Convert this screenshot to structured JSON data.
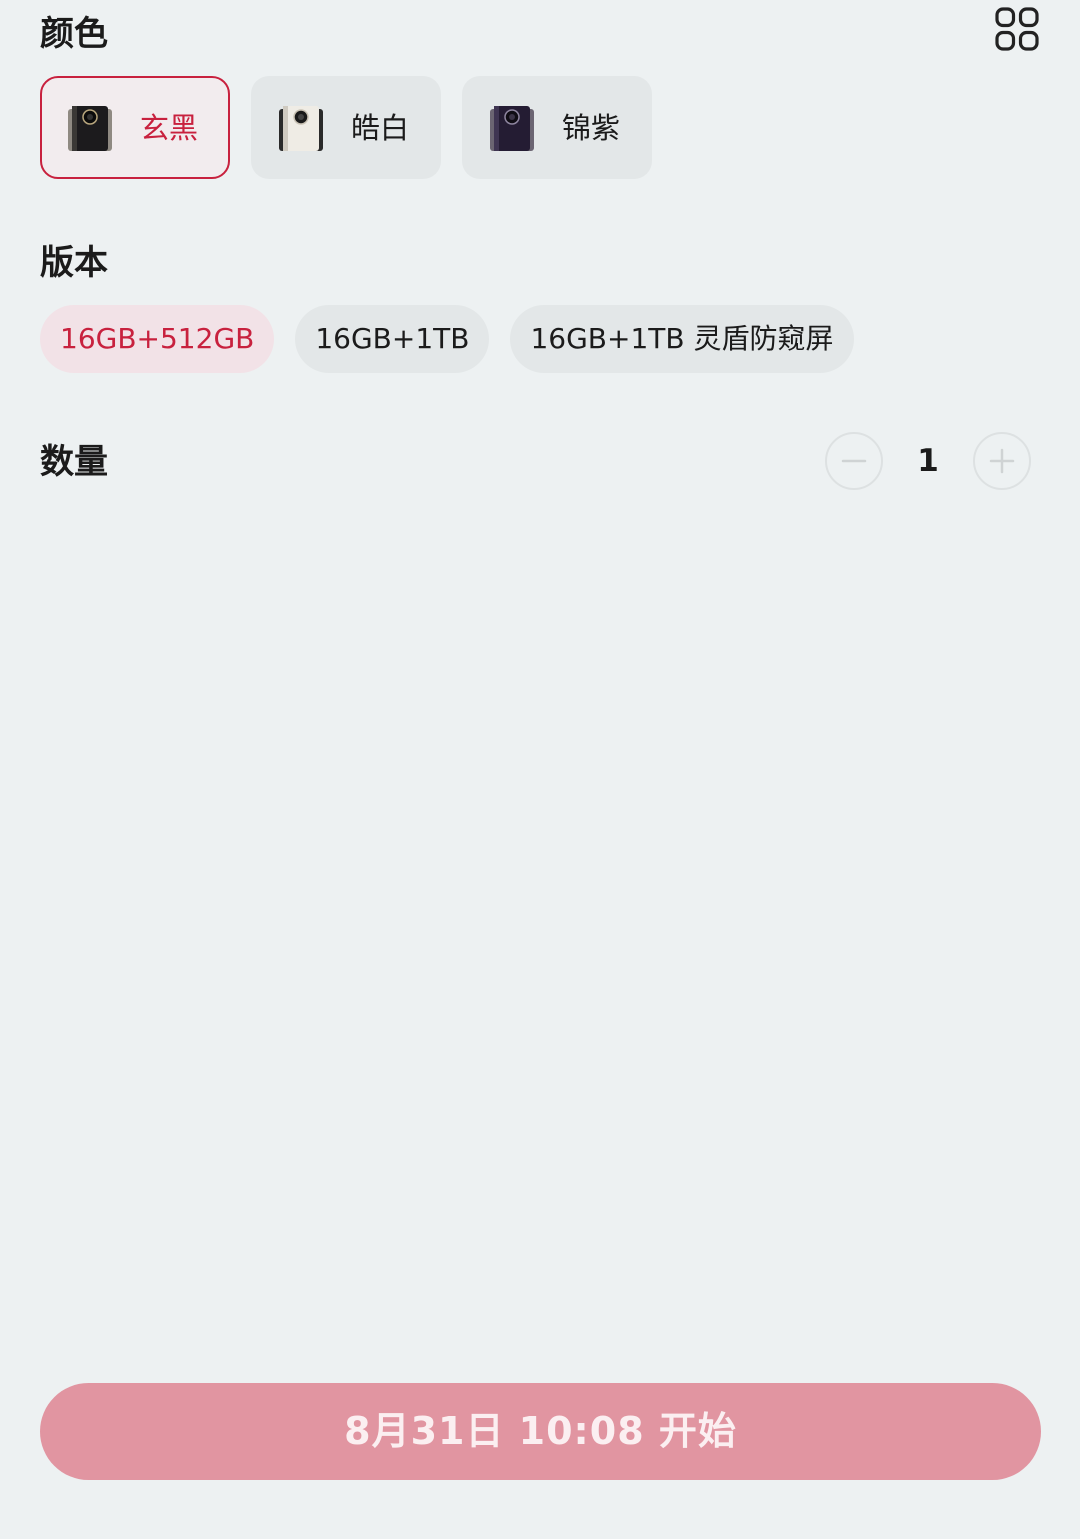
{
  "sections": {
    "color_title": "颜色",
    "version_title": "版本",
    "quantity_title": "数量"
  },
  "colors": [
    {
      "label": "玄黑",
      "selected": true,
      "swatch": "#1c1b1d"
    },
    {
      "label": "皓白",
      "selected": false,
      "swatch": "#efece5"
    },
    {
      "label": "锦紫",
      "selected": false,
      "swatch": "#241c33"
    }
  ],
  "versions": [
    {
      "label": "16GB+512GB",
      "selected": true
    },
    {
      "label": "16GB+1TB",
      "selected": false
    },
    {
      "label": "16GB+1TB 灵盾防窥屏",
      "selected": false
    }
  ],
  "quantity": {
    "value": "1",
    "decrement_icon": "minus-icon",
    "increment_icon": "plus-icon"
  },
  "toolbar": {
    "grid_icon": "grid-view-icon"
  },
  "action": {
    "label": "8月31日 10:08 开始"
  },
  "theme": {
    "accent": "#c8213e",
    "button_bg": "#e195a1",
    "page_bg": "#edf1f2"
  }
}
